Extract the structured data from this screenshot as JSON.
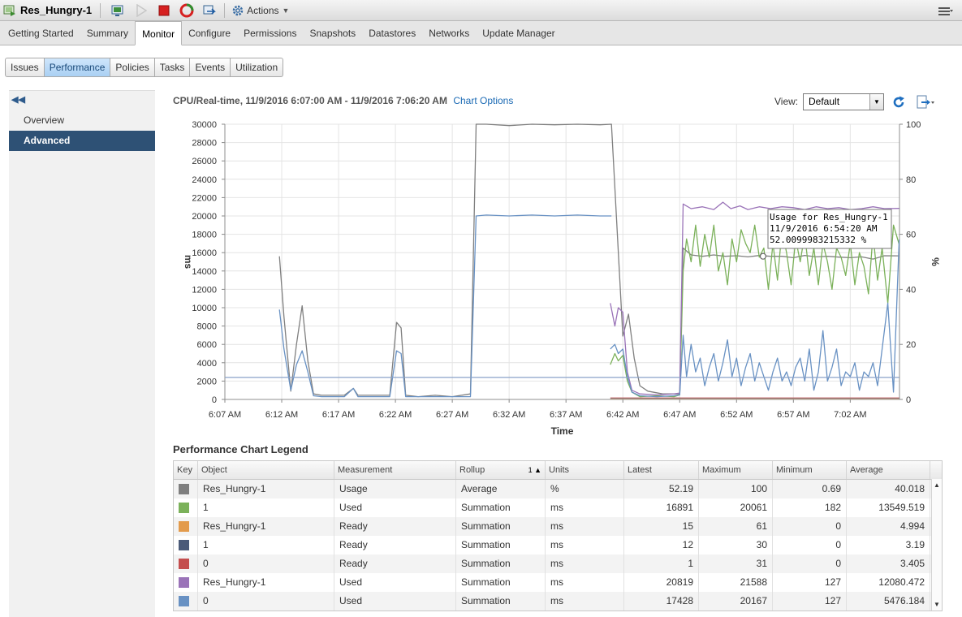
{
  "vm": {
    "name": "Res_Hungry-1"
  },
  "toolbar": {
    "actions_label": "Actions"
  },
  "tabs": [
    {
      "label": "Getting Started"
    },
    {
      "label": "Summary"
    },
    {
      "label": "Monitor",
      "active": true
    },
    {
      "label": "Configure"
    },
    {
      "label": "Permissions"
    },
    {
      "label": "Snapshots"
    },
    {
      "label": "Datastores"
    },
    {
      "label": "Networks"
    },
    {
      "label": "Update Manager"
    }
  ],
  "subtabs": [
    {
      "label": "Issues"
    },
    {
      "label": "Performance",
      "active": true
    },
    {
      "label": "Policies"
    },
    {
      "label": "Tasks"
    },
    {
      "label": "Events"
    },
    {
      "label": "Utilization"
    }
  ],
  "sidebar": {
    "items": [
      {
        "label": "Overview"
      },
      {
        "label": "Advanced",
        "active": true
      }
    ]
  },
  "chart_header": {
    "title": "CPU/Real-time, 11/9/2016 6:07:00 AM - 11/9/2016 7:06:20 AM",
    "options_link": "Chart Options",
    "view_label": "View:",
    "view_value": "Default"
  },
  "tooltip": {
    "line1": "Usage for Res_Hungry-1",
    "line2": "11/9/2016 6:54:20 AM",
    "line3": "52.0099983215332 %"
  },
  "chart_data": {
    "type": "line",
    "xlabel": "Time",
    "ylabel_left": "ms",
    "ylabel_right": "%",
    "ylim_left": [
      0,
      30000
    ],
    "ylim_right": [
      0,
      100
    ],
    "yticks_left": [
      "0",
      "2000",
      "4000",
      "6000",
      "8000",
      "10000",
      "12000",
      "14000",
      "16000",
      "18000",
      "20000",
      "22000",
      "24000",
      "26000",
      "28000",
      "30000"
    ],
    "yticks_right": [
      "0",
      "20",
      "40",
      "60",
      "80",
      "100"
    ],
    "xticks": [
      "6:07 AM",
      "6:12 AM",
      "6:17 AM",
      "6:22 AM",
      "6:27 AM",
      "6:32 AM",
      "6:37 AM",
      "6:42 AM",
      "6:47 AM",
      "6:52 AM",
      "6:57 AM",
      "7:02 AM"
    ],
    "x_minutes": [
      0,
      5,
      10,
      15,
      20,
      25,
      30,
      35,
      40,
      45,
      50,
      55
    ],
    "x_range_minutes": [
      0,
      59.33
    ],
    "grid": true,
    "series": [
      {
        "name": "Usage",
        "axis": "right",
        "color": "#7f7f7f",
        "points": [
          [
            4.8,
            52
          ],
          [
            5.2,
            30
          ],
          [
            5.8,
            3
          ],
          [
            6.3,
            20
          ],
          [
            6.8,
            34
          ],
          [
            7.3,
            14
          ],
          [
            7.8,
            2
          ],
          [
            8.5,
            1.5
          ],
          [
            9.5,
            1.5
          ],
          [
            10.5,
            1.5
          ],
          [
            11.3,
            4
          ],
          [
            11.7,
            1.5
          ],
          [
            13,
            1.5
          ],
          [
            14.5,
            1.5
          ],
          [
            15.1,
            28
          ],
          [
            15.5,
            26
          ],
          [
            15.9,
            1.5
          ],
          [
            17,
            1
          ],
          [
            18.5,
            1.5
          ],
          [
            20,
            1
          ],
          [
            21.6,
            2
          ],
          [
            22.1,
            100
          ],
          [
            23,
            100
          ],
          [
            25,
            99.5
          ],
          [
            27,
            100
          ],
          [
            29,
            99.8
          ],
          [
            31,
            100
          ],
          [
            33,
            99.8
          ],
          [
            34,
            100
          ],
          [
            35,
            23
          ],
          [
            35.5,
            31
          ],
          [
            36,
            15
          ],
          [
            36.5,
            5
          ],
          [
            37.2,
            3
          ],
          [
            38.5,
            2
          ],
          [
            40,
            2
          ],
          [
            40.3,
            55
          ],
          [
            41,
            52.5
          ],
          [
            42,
            52
          ],
          [
            43,
            52.5
          ],
          [
            44,
            52
          ],
          [
            45,
            52.2
          ],
          [
            46,
            51.8
          ],
          [
            47,
            52.3
          ],
          [
            48,
            52
          ],
          [
            49,
            52
          ],
          [
            50,
            51.5
          ],
          [
            51,
            52.3
          ],
          [
            52,
            51.8
          ],
          [
            53,
            52
          ],
          [
            54,
            51.7
          ],
          [
            55,
            51.5
          ],
          [
            56,
            51.8
          ],
          [
            57,
            51
          ],
          [
            58,
            52.2
          ],
          [
            59.3,
            52.19
          ]
        ]
      },
      {
        "name": "Used (1)",
        "axis": "left",
        "color": "#7bb15a",
        "points": [
          [
            33.9,
            3800
          ],
          [
            34.3,
            5000
          ],
          [
            34.6,
            4200
          ],
          [
            35,
            4800
          ],
          [
            35.4,
            2000
          ],
          [
            35.8,
            800
          ],
          [
            36.5,
            300
          ],
          [
            38,
            400
          ],
          [
            39.5,
            300
          ],
          [
            40,
            500
          ],
          [
            40.3,
            14000
          ],
          [
            40.6,
            17500
          ],
          [
            41,
            15000
          ],
          [
            41.4,
            19000
          ],
          [
            41.8,
            14500
          ],
          [
            42.2,
            18000
          ],
          [
            42.6,
            15500
          ],
          [
            43,
            19000
          ],
          [
            43.4,
            14000
          ],
          [
            43.8,
            16000
          ],
          [
            44.2,
            12500
          ],
          [
            44.6,
            17500
          ],
          [
            45,
            15000
          ],
          [
            45.4,
            18500
          ],
          [
            45.8,
            17000
          ],
          [
            46.2,
            16000
          ],
          [
            46.6,
            19000
          ],
          [
            47,
            15500
          ],
          [
            47.4,
            16500
          ],
          [
            47.8,
            12000
          ],
          [
            48.2,
            17000
          ],
          [
            48.6,
            13000
          ],
          [
            49,
            18500
          ],
          [
            49.4,
            16000
          ],
          [
            49.8,
            12500
          ],
          [
            50.2,
            17500
          ],
          [
            50.6,
            15000
          ],
          [
            51,
            18000
          ],
          [
            51.4,
            13500
          ],
          [
            51.8,
            16500
          ],
          [
            52.2,
            12500
          ],
          [
            52.6,
            17000
          ],
          [
            53,
            15000
          ],
          [
            53.4,
            12000
          ],
          [
            53.8,
            16500
          ],
          [
            54.2,
            15500
          ],
          [
            54.6,
            13500
          ],
          [
            55,
            17000
          ],
          [
            55.4,
            12500
          ],
          [
            55.8,
            16000
          ],
          [
            56.2,
            14500
          ],
          [
            56.6,
            11500
          ],
          [
            57,
            18000
          ],
          [
            57.4,
            13000
          ],
          [
            57.8,
            16500
          ],
          [
            58.3,
            10500
          ],
          [
            58.8,
            19000
          ],
          [
            59.3,
            16891
          ]
        ]
      },
      {
        "name": "Used (Res_Hungry-1)",
        "axis": "left",
        "color": "#9a73b8",
        "points": [
          [
            33.9,
            10500
          ],
          [
            34.3,
            8000
          ],
          [
            34.6,
            10000
          ],
          [
            35,
            9500
          ],
          [
            35.4,
            3000
          ],
          [
            35.8,
            1000
          ],
          [
            36.5,
            600
          ],
          [
            38,
            500
          ],
          [
            39.5,
            600
          ],
          [
            40,
            700
          ],
          [
            40.3,
            21300
          ],
          [
            41,
            20800
          ],
          [
            42,
            21000
          ],
          [
            43,
            20700
          ],
          [
            43.8,
            21500
          ],
          [
            44.5,
            20800
          ],
          [
            45.3,
            21100
          ],
          [
            46,
            20700
          ],
          [
            47,
            21000
          ],
          [
            48,
            20800
          ],
          [
            49,
            21000
          ],
          [
            50,
            20900
          ],
          [
            51,
            20700
          ],
          [
            52,
            21000
          ],
          [
            53,
            20800
          ],
          [
            54,
            20900
          ],
          [
            55,
            20700
          ],
          [
            56,
            20800
          ],
          [
            57,
            21000
          ],
          [
            58,
            20800
          ],
          [
            59.3,
            20819
          ]
        ]
      },
      {
        "name": "Used (0)",
        "axis": "left",
        "color": "#6891c3",
        "points": [
          [
            4.8,
            9800
          ],
          [
            5.2,
            5500
          ],
          [
            5.8,
            1000
          ],
          [
            6.3,
            3800
          ],
          [
            6.8,
            5300
          ],
          [
            7.3,
            3000
          ],
          [
            7.8,
            400
          ],
          [
            8.5,
            300
          ],
          [
            9.5,
            300
          ],
          [
            10.5,
            300
          ],
          [
            11.3,
            1200
          ],
          [
            11.7,
            300
          ],
          [
            13,
            300
          ],
          [
            14.5,
            300
          ],
          [
            15.1,
            5300
          ],
          [
            15.5,
            5000
          ],
          [
            15.9,
            300
          ],
          [
            17,
            300
          ],
          [
            18.5,
            300
          ],
          [
            20,
            300
          ],
          [
            21.6,
            300
          ],
          [
            22.1,
            20000
          ],
          [
            23,
            20100
          ],
          [
            25,
            20000
          ],
          [
            27,
            20100
          ],
          [
            29,
            20000
          ],
          [
            31,
            20100
          ],
          [
            33,
            20000
          ],
          [
            34,
            20000
          ],
          [
            33.9,
            5500
          ],
          [
            34.3,
            6000
          ],
          [
            34.6,
            5000
          ],
          [
            35,
            5500
          ],
          [
            35.4,
            2500
          ],
          [
            35.8,
            800
          ],
          [
            36.5,
            400
          ],
          [
            38,
            300
          ],
          [
            39.5,
            400
          ],
          [
            40,
            500
          ],
          [
            40.3,
            7000
          ],
          [
            40.6,
            2500
          ],
          [
            41,
            6000
          ],
          [
            41.4,
            3000
          ],
          [
            41.8,
            4500
          ],
          [
            42.2,
            1500
          ],
          [
            42.6,
            3500
          ],
          [
            43,
            5000
          ],
          [
            43.4,
            2000
          ],
          [
            43.8,
            4000
          ],
          [
            44.2,
            6500
          ],
          [
            44.6,
            2500
          ],
          [
            45,
            4500
          ],
          [
            45.4,
            1500
          ],
          [
            45.8,
            3500
          ],
          [
            46.2,
            5000
          ],
          [
            46.6,
            2000
          ],
          [
            47,
            4000
          ],
          [
            47.4,
            2500
          ],
          [
            47.8,
            1000
          ],
          [
            48.2,
            3000
          ],
          [
            48.6,
            4500
          ],
          [
            49,
            2000
          ],
          [
            49.4,
            3000
          ],
          [
            49.8,
            1500
          ],
          [
            50.2,
            3500
          ],
          [
            50.6,
            4500
          ],
          [
            51,
            2000
          ],
          [
            51.4,
            5500
          ],
          [
            51.8,
            1000
          ],
          [
            52.2,
            3000
          ],
          [
            52.6,
            7500
          ],
          [
            53,
            2000
          ],
          [
            53.4,
            3500
          ],
          [
            53.8,
            5500
          ],
          [
            54.2,
            1500
          ],
          [
            54.6,
            3000
          ],
          [
            55,
            2500
          ],
          [
            55.4,
            4000
          ],
          [
            55.8,
            1000
          ],
          [
            56.2,
            3000
          ],
          [
            56.6,
            2500
          ],
          [
            57,
            4000
          ],
          [
            57.4,
            1500
          ],
          [
            57.8,
            5500
          ],
          [
            58.3,
            10500
          ],
          [
            58.8,
            800
          ],
          [
            59.3,
            17428
          ]
        ]
      },
      {
        "name": "Ready",
        "axis": "left",
        "color": "#8aa2c9",
        "points": [
          [
            0,
            2400
          ],
          [
            59.3,
            2400
          ]
        ]
      }
    ]
  },
  "legend": {
    "title": "Performance Chart Legend",
    "columns": [
      "Key",
      "Object",
      "Measurement",
      "Rollup",
      "Units",
      "Latest",
      "Maximum",
      "Minimum",
      "Average"
    ],
    "sort_indicator": "1",
    "rows": [
      {
        "color": "#7f7f7f",
        "object": "Res_Hungry-1",
        "measurement": "Usage",
        "rollup": "Average",
        "units": "%",
        "latest": "52.19",
        "maximum": "100",
        "minimum": "0.69",
        "average": "40.018"
      },
      {
        "color": "#7bb15a",
        "object": "1",
        "measurement": "Used",
        "rollup": "Summation",
        "units": "ms",
        "latest": "16891",
        "maximum": "20061",
        "minimum": "182",
        "average": "13549.519"
      },
      {
        "color": "#e39b4c",
        "object": "Res_Hungry-1",
        "measurement": "Ready",
        "rollup": "Summation",
        "units": "ms",
        "latest": "15",
        "maximum": "61",
        "minimum": "0",
        "average": "4.994"
      },
      {
        "color": "#4b5a78",
        "object": "1",
        "measurement": "Ready",
        "rollup": "Summation",
        "units": "ms",
        "latest": "12",
        "maximum": "30",
        "minimum": "0",
        "average": "3.19"
      },
      {
        "color": "#c44d4d",
        "object": "0",
        "measurement": "Ready",
        "rollup": "Summation",
        "units": "ms",
        "latest": "1",
        "maximum": "31",
        "minimum": "0",
        "average": "3.405"
      },
      {
        "color": "#9a73b8",
        "object": "Res_Hungry-1",
        "measurement": "Used",
        "rollup": "Summation",
        "units": "ms",
        "latest": "20819",
        "maximum": "21588",
        "minimum": "127",
        "average": "12080.472"
      },
      {
        "color": "#6891c3",
        "object": "0",
        "measurement": "Used",
        "rollup": "Summation",
        "units": "ms",
        "latest": "17428",
        "maximum": "20167",
        "minimum": "127",
        "average": "5476.184"
      }
    ]
  }
}
